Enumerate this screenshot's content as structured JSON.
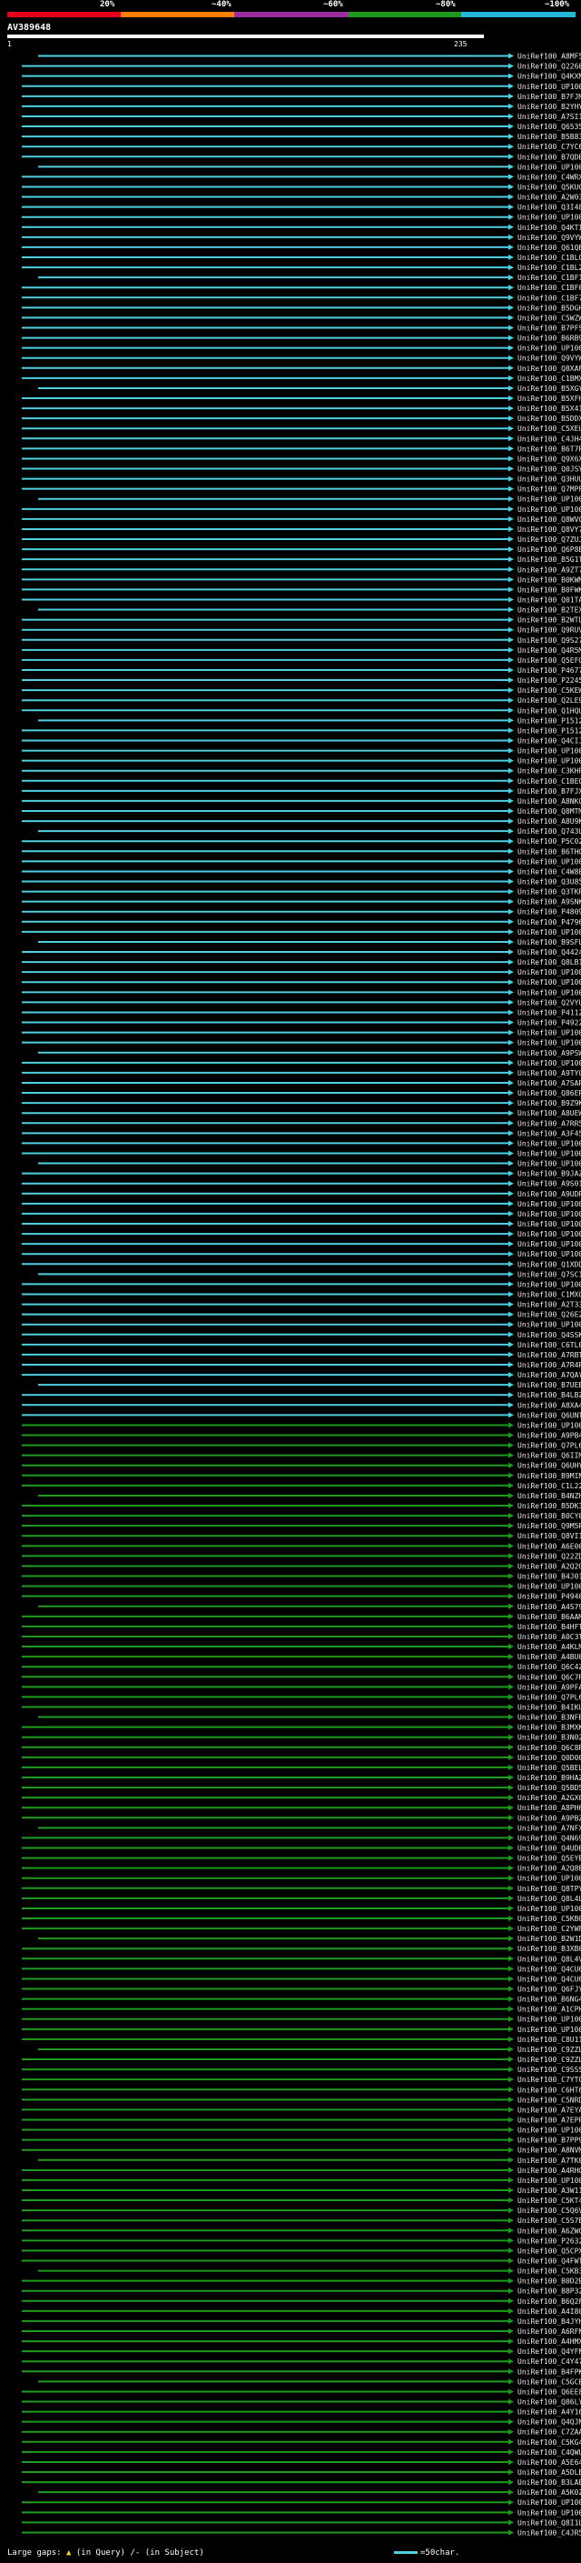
{
  "header": {
    "scale_labels": [
      "20%",
      "~40%",
      "~60%",
      "~80%",
      "~100%"
    ],
    "scale_colors": [
      "#e2001a",
      "#ff7f00",
      "#9c2aa0",
      "#1e9b1e",
      "#26b8d8"
    ],
    "query_name": "AV389648",
    "query_start": "1",
    "query_end": "235"
  },
  "colors": {
    "cyan_hit": "#4fd0e0",
    "green_hit": "#1e9b1e",
    "label_text": "#e8e8e8",
    "background": "#000000"
  },
  "hits": {
    "labels": [
      "UniRef100_A8MF55",
      "UniRef100_Q22608",
      "UniRef100_Q4KXN1",
      "UniRef100_UP1000...",
      "UniRef100_B7FJM5",
      "UniRef100_B2YHY0",
      "UniRef100_A7SI19",
      "UniRef100_Q65353",
      "UniRef100_B5B839",
      "UniRef100_C7YC66",
      "UniRef100_B7QDE4",
      "UniRef100_UP1000...",
      "UniRef100_C4WRX7",
      "UniRef100_Q5KUC7",
      "UniRef100_A2W033",
      "UniRef100_Q3I481",
      "UniRef100_UP1000...",
      "UniRef100_Q4KTI3",
      "UniRef100_Q9VYW6",
      "UniRef100_Q61QB1",
      "UniRef100_C1BLC4",
      "UniRef100_C1BL29",
      "UniRef100_C1BF17",
      "UniRef100_C1BF07",
      "UniRef100_C1BF77",
      "UniRef100_B5DGH0",
      "UniRef100_C5WZW1",
      "UniRef100_B7PFS8",
      "UniRef100_B6RB96",
      "UniRef100_UP1000...",
      "UniRef100_Q9VYW5",
      "UniRef100_Q8XAF7",
      "UniRef100_C1BMX2",
      "UniRef100_B5XGY2",
      "UniRef100_B5XFH1",
      "UniRef100_B5X413",
      "UniRef100_B5DDX0",
      "UniRef100_C5XEU2",
      "UniRef100_C4JH45",
      "UniRef100_B6T7P7",
      "UniRef100_Q9X6X9",
      "UniRef100_Q0JSY1",
      "UniRef100_Q3HUU5",
      "UniRef100_Q7MPF1",
      "UniRef100_UP1000...",
      "UniRef100_UP1000...",
      "UniRef100_Q8WVC2",
      "UniRef100_Q8VY77",
      "UniRef100_Q7ZUJ4",
      "UniRef100_Q6P8E3",
      "UniRef100_B5G1T4",
      "UniRef100_A9ZT78",
      "UniRef100_B0KWM5",
      "UniRef100_B0FWK5",
      "UniRef100_Q01TA8",
      "UniRef100_B2TEX9",
      "UniRef100_B2WTL2",
      "UniRef100_Q9RUV4",
      "UniRef100_Q9S276",
      "UniRef100_Q4R5M0",
      "UniRef100_Q5EFG6",
      "UniRef100_P46777",
      "UniRef100_P22451",
      "UniRef100_C5KEW8",
      "UniRef100_Q2LE90",
      "UniRef100_Q1HQU2",
      "UniRef100_P15126",
      "UniRef100_P15125",
      "UniRef100_Q4CIJ8",
      "UniRef100_UP1000...",
      "UniRef100_UP1000...",
      "UniRef100_C3KHP7",
      "UniRef100_C1BEQ7",
      "UniRef100_B7FJX5",
      "UniRef100_A8NKC3",
      "UniRef100_Q8MTM3",
      "UniRef100_A8U9K9",
      "UniRef100_Q743U6",
      "UniRef100_P5C022",
      "UniRef100_B6THG9",
      "UniRef100_UP1000...",
      "UniRef100_C4W8E8",
      "UniRef100_Q3U850",
      "UniRef100_Q3TKR5",
      "UniRef100_A9SNK8",
      "UniRef100_P48095",
      "UniRef100_P47962",
      "UniRef100_UP1000...",
      "UniRef100_B9SFU0",
      "UniRef100_Q44248",
      "UniRef100_Q8LB11",
      "UniRef100_UP1000...",
      "UniRef100_UP1000...",
      "UniRef100_UP1000...",
      "UniRef100_Q2VYU6",
      "UniRef100_P41125",
      "UniRef100_P49227",
      "UniRef100_UP1000...",
      "UniRef100_UP1000...",
      "UniRef100_A9PSW9",
      "UniRef100_UP1000...",
      "UniRef100_A9TYC5",
      "UniRef100_A7SAP7",
      "UniRef100_Q86EP8",
      "UniRef100_B9Z9K8",
      "UniRef100_A8UEW1",
      "UniRef100_A7RR58",
      "UniRef100_A3F454",
      "UniRef100_UP1000...",
      "UniRef100_UP1000...",
      "UniRef100_UP1000...",
      "UniRef100_B9JAZ4",
      "UniRef100_A9S013",
      "UniRef100_A9UDR2",
      "UniRef100_UP1000...",
      "UniRef100_UP1000...",
      "UniRef100_UP1000...",
      "UniRef100_UP1000...",
      "UniRef100_UP1000...",
      "UniRef100_UP1000...",
      "UniRef100_Q1XDDI",
      "UniRef100_Q7SC13",
      "UniRef100_UP1000...",
      "UniRef100_C1MXG8",
      "UniRef100_A2T337",
      "UniRef100_Q26E22",
      "UniRef100_UP1000...",
      "UniRef100_Q4SSK4",
      "UniRef100_C6TL04",
      "UniRef100_A7RBT7",
      "UniRef100_A7R4R2",
      "UniRef100_A7QAY5",
      "UniRef100_B7UEB4",
      "UniRef100_B4LBZE",
      "UniRef100_A8XA44",
      "UniRef100_Q6UNT2",
      "UniRef100_UP1000...",
      "UniRef100_A9PB43",
      "UniRef100_Q7PL68",
      "UniRef100_Q6IIM1",
      "UniRef100_Q6UHY2",
      "UniRef100_B9MIN0",
      "UniRef100_C1L227",
      "UniRef100_B4NZH3",
      "UniRef100_B5DK39",
      "UniRef100_B0CY08",
      "UniRef100_Q9M5R8",
      "UniRef100_Q8VI15",
      "UniRef100_A6E008",
      "UniRef100_Q22ZD4",
      "UniRef100_A2Q2Q4",
      "UniRef100_B4J019",
      "UniRef100_UP1000...",
      "UniRef100_P49405",
      "UniRef100_A4S796",
      "UniRef100_B6AAM9",
      "UniRef100_B4HFT7",
      "UniRef100_A0C3T5",
      "UniRef100_A4KLM5",
      "UniRef100_A4BU03",
      "UniRef100_Q6C4Z8",
      "UniRef100_Q6C7R7",
      "UniRef100_A9PFA8",
      "UniRef100_Q7PL67",
      "UniRef100_B4IKU1",
      "UniRef100_B3NFB1",
      "UniRef100_B3MXK9",
      "UniRef100_B3N025",
      "UniRef100_Q6C8R9",
      "UniRef100_Q0D003",
      "UniRef100_Q5BEL7",
      "UniRef100_B9HAZ3",
      "UniRef100_Q5BD51",
      "UniRef100_A2GX03",
      "UniRef100_A8PH69",
      "UniRef100_A9PBZ9",
      "UniRef100_A7NFX9",
      "UniRef100_Q4N695",
      "UniRef100_Q4UDE7",
      "UniRef100_Q5EYB9",
      "UniRef100_A2Q8E4",
      "UniRef100_UP1000...",
      "UniRef100_Q8TPY0",
      "UniRef100_Q8L4L4",
      "UniRef100_UP1000...",
      "UniRef100_C5KB00",
      "UniRef100_C2YWF0",
      "UniRef100_B2W1D9",
      "UniRef100_B3XB02",
      "UniRef100_Q8L4V2",
      "UniRef100_Q4CU61",
      "UniRef100_Q4CU60",
      "UniRef100_Q6FJY0",
      "UniRef100_B6NG46",
      "UniRef100_A1CPH2",
      "UniRef100_UP1000...",
      "UniRef100_UP1000...",
      "UniRef100_C8U114",
      "UniRef100_C9ZZL3",
      "UniRef100_C9ZZL2",
      "UniRef100_C9SSS4",
      "UniRef100_C7YTC1",
      "UniRef100_C6HT62",
      "UniRef100_C5NRD6",
      "UniRef100_A7EYA0",
      "UniRef100_A7EPP7",
      "UniRef100_UP1000...",
      "UniRef100_B7PP90",
      "UniRef100_A8NVM3",
      "UniRef100_A7TK05",
      "UniRef100_A4RHG5",
      "UniRef100_UP1000...",
      "UniRef100_A3W111",
      "UniRef100_C5KT46",
      "UniRef100_C5Q6V3",
      "UniRef100_C5S7B1",
      "UniRef100_A6ZWC1",
      "UniRef100_P26321",
      "UniRef100_Q5CPX4",
      "UniRef100_Q4FWT2",
      "UniRef100_C5KB34",
      "UniRef100_B0D2E6",
      "UniRef100_B8P326",
      "UniRef100_B6Q2F0",
      "UniRef100_A4I800",
      "UniRef100_B4JYH7",
      "UniRef100_A6RFN8",
      "UniRef100_A4HMX3",
      "UniRef100_Q4YFN4",
      "UniRef100_C4Y475",
      "UniRef100_B4FPK0",
      "UniRef100_C5GCB5",
      "UniRef100_Q6EE83",
      "UniRef100_Q86LY6",
      "UniRef100_A4Y162",
      "UniRef100_Q4QJN2",
      "UniRef100_C7ZAA0",
      "UniRef100_C5KG47",
      "UniRef100_C4QWU8",
      "UniRef100_A5E640",
      "UniRef100_A5DLB6",
      "UniRef100_B3LAE0",
      "UniRef100_A5K0Z7",
      "UniRef100_UP1000...",
      "UniRef100_UP1000...",
      "UniRef100_Q8I1L3",
      "UniRef100_C4JR53"
    ]
  },
  "footer": {
    "gaps_label": "Large gaps:",
    "gaps_query": "(in Query)",
    "gaps_separator": "/-",
    "gaps_subject": "(in Subject)",
    "scale_text": "=50char."
  }
}
